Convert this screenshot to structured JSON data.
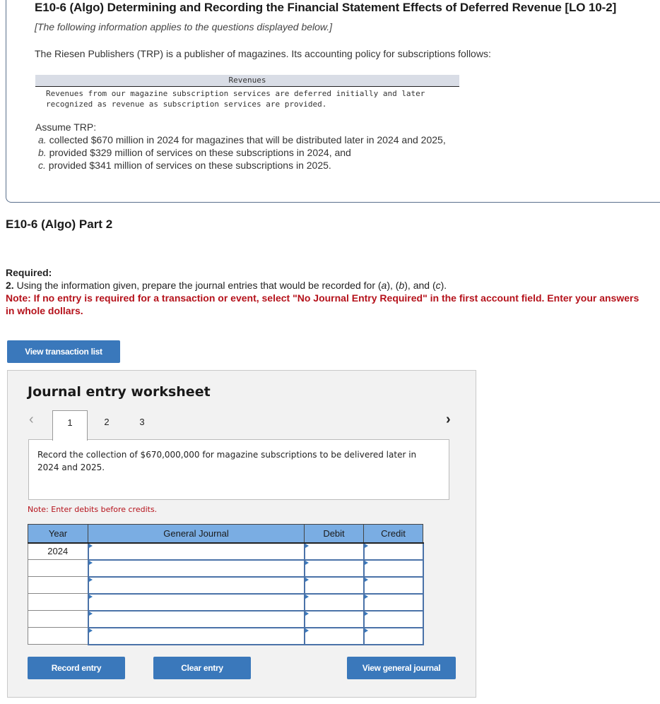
{
  "header": {
    "title": "E10-6 (Algo) Determining and Recording the Financial Statement Effects of Deferred Revenue [LO 10-2]",
    "subtitle": "[The following information applies to the questions displayed below.]",
    "intro": "The Riesen Publishers (TRP) is a publisher of magazines. Its accounting policy for subscriptions follows:"
  },
  "policy": {
    "heading": "Revenues",
    "line1": "Revenues from our magazine subscription services are deferred initially and later",
    "line2": "recognized as revenue as subscription services are provided."
  },
  "assumptions": {
    "lead": "Assume TRP:",
    "items": [
      {
        "letter": "a.",
        "text": " collected $670 million in 2024 for magazines that will be distributed later in 2024 and 2025,"
      },
      {
        "letter": "b.",
        "text": " provided $329 million of services on these subscriptions in 2024, and"
      },
      {
        "letter": "c.",
        "text": " provided $341 million of services on these subscriptions in 2025."
      }
    ]
  },
  "part": {
    "title": "E10-6 (Algo) Part 2",
    "required_label": "Required:",
    "req_number": "2.",
    "req_text_1": " Using the information given, prepare the journal entries that would be recorded for (",
    "req_a": "a",
    "req_sep1": "), (",
    "req_b": "b",
    "req_sep2": "), and (",
    "req_c": "c",
    "req_end": ").",
    "note": "Note: If no entry is required for a transaction or event, select \"No Journal Entry Required\" in the first account field. Enter your answers in whole dollars."
  },
  "buttons": {
    "view_transaction_list": "View transaction list",
    "record_entry": "Record entry",
    "clear_entry": "Clear entry",
    "view_general_journal": "View general journal"
  },
  "worksheet": {
    "title": "Journal entry worksheet",
    "prev_icon": "‹",
    "next_icon": "›",
    "tabs": [
      {
        "label": "1",
        "active": true
      },
      {
        "label": "2",
        "active": false
      },
      {
        "label": "3",
        "active": false
      }
    ],
    "description": "Record the collection of $670,000,000 for magazine subscriptions to be delivered later in 2024 and 2025.",
    "note": "Note: Enter debits before credits.",
    "columns": [
      "Year",
      "General Journal",
      "Debit",
      "Credit"
    ],
    "rows": [
      {
        "year": "2024",
        "account": "",
        "debit": "",
        "credit": ""
      },
      {
        "year": "",
        "account": "",
        "debit": "",
        "credit": ""
      },
      {
        "year": "",
        "account": "",
        "debit": "",
        "credit": ""
      },
      {
        "year": "",
        "account": "",
        "debit": "",
        "credit": ""
      },
      {
        "year": "",
        "account": "",
        "debit": "",
        "credit": ""
      },
      {
        "year": "",
        "account": "",
        "debit": "",
        "credit": ""
      }
    ]
  }
}
